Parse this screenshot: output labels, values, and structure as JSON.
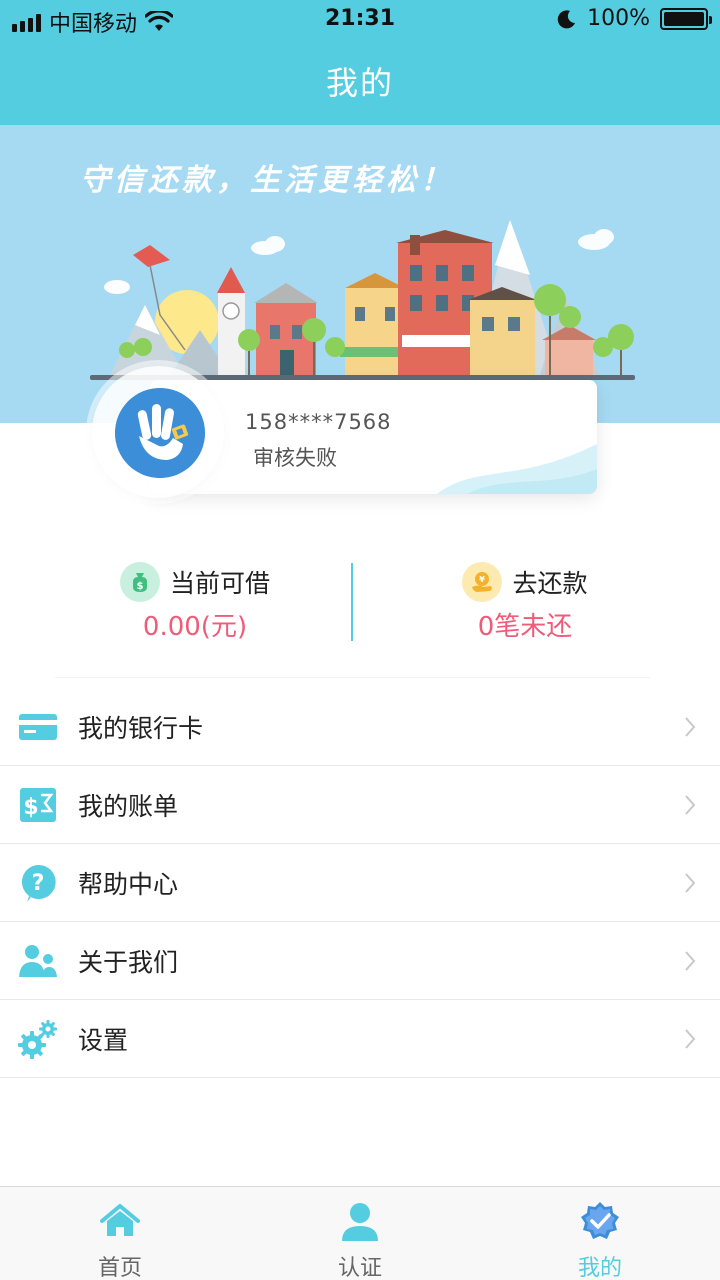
{
  "status_bar": {
    "carrier": "中国移动",
    "time": "21:31",
    "battery_text": "100%",
    "battery_level": 1.0
  },
  "nav": {
    "title": "我的"
  },
  "banner": {
    "slogan": "守信还款，生活更轻松！"
  },
  "profile": {
    "phone": "158****7568",
    "status": "审核失败",
    "avatar_icon": "ok-hand-icon"
  },
  "stats": {
    "borrow": {
      "icon": "money-bag-icon",
      "title": "当前可借",
      "value": "0.00(元)"
    },
    "repay": {
      "icon": "coin-hand-icon",
      "title": "去还款",
      "value": "0笔未还"
    }
  },
  "menu": [
    {
      "label": "我的银行卡",
      "icon": "bank-card-icon"
    },
    {
      "label": "我的账单",
      "icon": "bill-icon"
    },
    {
      "label": "帮助中心",
      "icon": "help-icon"
    },
    {
      "label": "关于我们",
      "icon": "users-icon"
    },
    {
      "label": "设置",
      "icon": "gear-icon"
    }
  ],
  "tabbar": [
    {
      "label": "首页",
      "icon": "home-icon",
      "active": false
    },
    {
      "label": "认证",
      "icon": "person-icon",
      "active": false
    },
    {
      "label": "我的",
      "icon": "verified-badge-icon",
      "active": true
    }
  ],
  "colors": {
    "primary": "#54cde0",
    "accent_red": "#f05b79",
    "banner_sky": "#a6daf3",
    "text": "#222222"
  }
}
